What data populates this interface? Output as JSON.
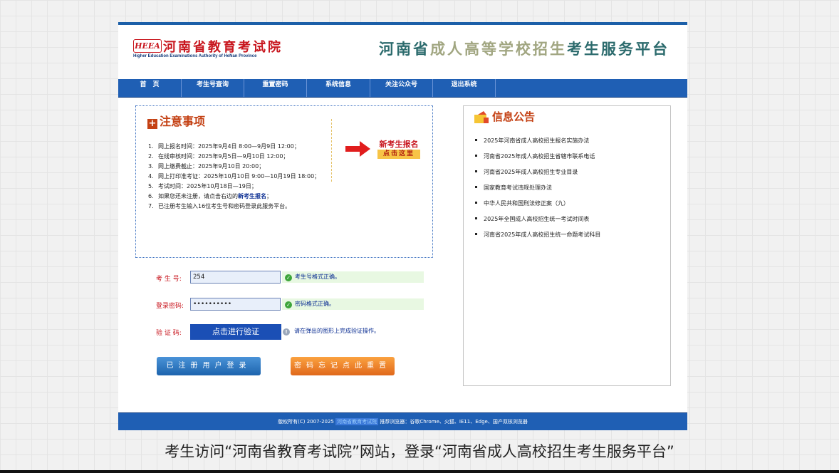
{
  "header": {
    "logo_mark": "HEEA",
    "logo_name": "河南省教育考试院",
    "logo_en": "Higher Education Examinations Authority of HeNan Province",
    "platform_part1": "河南省",
    "platform_part2": "成人高等学校招生",
    "platform_part3": "考生服务平台"
  },
  "nav": [
    "首　页",
    "考生号查询",
    "重置密码",
    "系统信息",
    "关注公众号",
    "退出系统"
  ],
  "notice": {
    "title": "注意事项",
    "items": [
      {
        "num": "1.",
        "text": "网上报名时间：2025年9月4日 8:00—9月9日 12:00；"
      },
      {
        "num": "2.",
        "text": "在线审核时间：2025年9月5日—9月10日 12:00；"
      },
      {
        "num": "3.",
        "text": "网上缴费截止：2025年9月10日 20:00；"
      },
      {
        "num": "4.",
        "text": "网上打印准考证：2025年10月10日 9:00—10月19日 18:00；"
      },
      {
        "num": "5.",
        "text": "考试时间：2025年10月18日—19日；"
      },
      {
        "num": "6.",
        "text_before": "如果您还未注册，请点击右边的",
        "text_bold": "新考生报名",
        "text_after": "；"
      },
      {
        "num": "7.",
        "text": "已注册考生输入16位考生号和密码登录此服务平台。"
      }
    ],
    "register_title": "新考生报名",
    "register_button": "点击这里"
  },
  "info": {
    "title": "信息公告",
    "items": [
      "2025年河南省成人高校招生报名实施办法",
      "河南省2025年成人高校招生省辖市联系电话",
      "河南省2025年成人高校招生专业目录",
      "国家教育考试违规处理办法",
      "中华人民共和国刑法修正案（九）",
      "2025年全国成人高校招生统一考试时间表",
      "河南省2025年成人高校招生统一命题考试科目"
    ]
  },
  "form": {
    "exam_no_label": "考 生 号:",
    "exam_no_value": "254",
    "exam_no_hint": "考生号格式正确。",
    "password_label": "登录密码:",
    "password_value": "••••••••••",
    "password_hint": "密码格式正确。",
    "captcha_label": "验 证 码:",
    "captcha_button": "点击进行验证",
    "captcha_hint": "请在弹出的图形上完成验证操作。",
    "login_button": "已注册用户登录",
    "reset_button": "密码忘记点此重置"
  },
  "footer": {
    "copyright": "版权所有(C) 2007-2025",
    "org_link": "河南省教育考试院",
    "browsers": "推荐浏览器：谷歌Chrome、火狐、IE11、Edge、国产双核浏览器"
  },
  "caption": "考生访问“河南省教育考试院”网站，登录“河南省成人高校招生考生服务平台”",
  "colors": {
    "nav_blue": "#1f5fb4",
    "brand_red": "#c8161e",
    "title_teal": "#2c6b6d",
    "orange": "#e0681b"
  }
}
